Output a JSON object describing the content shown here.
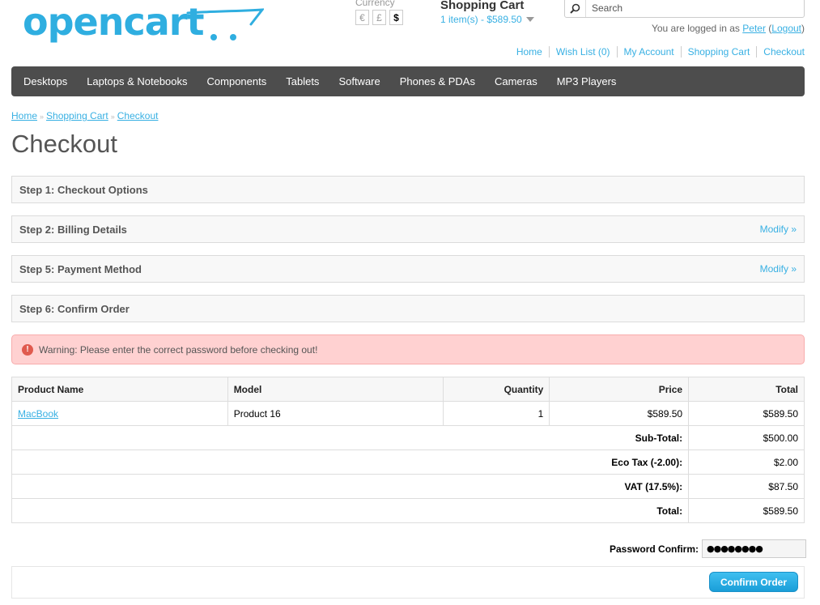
{
  "brand": {
    "logo_text": "opencart",
    "accent": "#38b0e3",
    "menu_bg": "#4d4d4d"
  },
  "currency": {
    "label": "Currency",
    "options": [
      "€",
      "£",
      "$"
    ],
    "selected": "$"
  },
  "cart": {
    "title": "Shopping Cart",
    "summary": "1 item(s) - $589.50"
  },
  "search": {
    "placeholder": "Search"
  },
  "welcome": {
    "prefix": "You are logged in as",
    "user": "Peter",
    "open": "(",
    "logout": "Logout",
    "close": ")"
  },
  "top_links": [
    "Home",
    "Wish List (0)",
    "My Account",
    "Shopping Cart",
    "Checkout"
  ],
  "menu": [
    "Desktops",
    "Laptops & Notebooks",
    "Components",
    "Tablets",
    "Software",
    "Phones & PDAs",
    "Cameras",
    "MP3 Players"
  ],
  "breadcrumb": [
    "Home",
    "Shopping Cart",
    "Checkout"
  ],
  "page_title": "Checkout",
  "steps": [
    {
      "title": "Step 1: Checkout Options",
      "modify": ""
    },
    {
      "title": "Step 2: Billing Details",
      "modify": "Modify »"
    },
    {
      "title": "Step 5: Payment Method",
      "modify": "Modify »"
    },
    {
      "title": "Step 6: Confirm Order",
      "modify": ""
    }
  ],
  "warning": {
    "text": "Warning: Please enter the correct password before checking out!",
    "color": "#ffd1d1"
  },
  "table": {
    "headers": [
      "Product Name",
      "Model",
      "Quantity",
      "Price",
      "Total"
    ],
    "rows": [
      {
        "name": "MacBook",
        "model": "Product 16",
        "quantity": "1",
        "price": "$589.50",
        "total": "$589.50"
      }
    ],
    "totals": [
      {
        "label": "Sub-Total:",
        "value": "$500.00"
      },
      {
        "label": "Eco Tax (-2.00):",
        "value": "$2.00"
      },
      {
        "label": "VAT (17.5%):",
        "value": "$87.50"
      },
      {
        "label": "Total:",
        "value": "$589.50"
      }
    ]
  },
  "password": {
    "label": "Password Confirm:",
    "value": "●●●●●●●●"
  },
  "confirm_button": "Confirm Order"
}
